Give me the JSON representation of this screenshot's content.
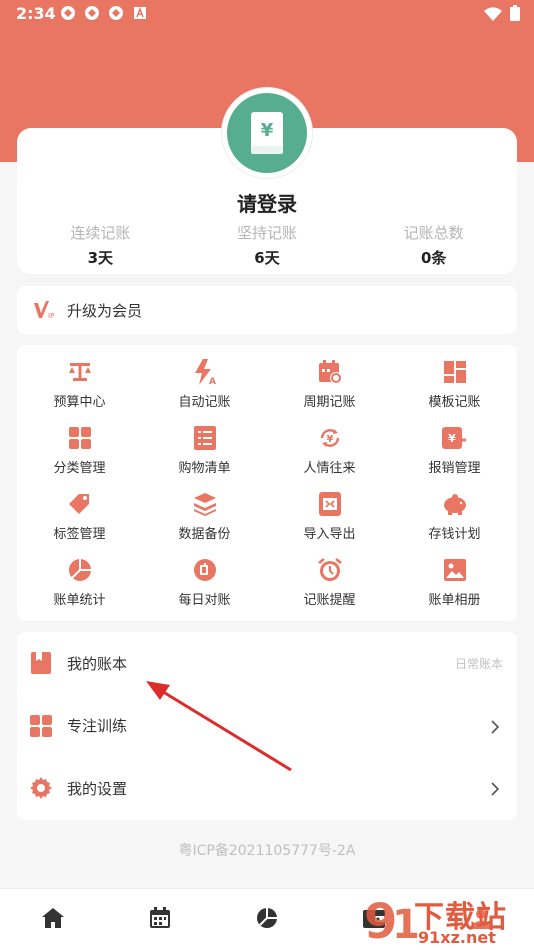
{
  "status_bar": {
    "time": "2:34"
  },
  "profile": {
    "title": "请登录",
    "stats": [
      {
        "label": "连续记账",
        "value": "3天"
      },
      {
        "label": "坚持记账",
        "value": "6天"
      },
      {
        "label": "记账总数",
        "value": "0条"
      }
    ]
  },
  "vip": {
    "label": "升级为会员"
  },
  "grid": {
    "items": [
      {
        "label": "预算中心",
        "icon": "scale-icon"
      },
      {
        "label": "自动记账",
        "icon": "auto-bolt-icon"
      },
      {
        "label": "周期记账",
        "icon": "calendar-cycle-icon"
      },
      {
        "label": "模板记账",
        "icon": "template-icon"
      },
      {
        "label": "分类管理",
        "icon": "category-grid-icon"
      },
      {
        "label": "购物清单",
        "icon": "list-icon"
      },
      {
        "label": "人情往来",
        "icon": "exchange-icon"
      },
      {
        "label": "报销管理",
        "icon": "reimburse-icon"
      },
      {
        "label": "标签管理",
        "icon": "tag-icon"
      },
      {
        "label": "数据备份",
        "icon": "layers-icon"
      },
      {
        "label": "导入导出",
        "icon": "excel-icon"
      },
      {
        "label": "存钱计划",
        "icon": "piggy-bank-icon"
      },
      {
        "label": "账单统计",
        "icon": "pie-chart-icon"
      },
      {
        "label": "每日对账",
        "icon": "daily-check-icon"
      },
      {
        "label": "记账提醒",
        "icon": "alarm-icon"
      },
      {
        "label": "账单相册",
        "icon": "photo-icon"
      }
    ]
  },
  "menu": {
    "books": {
      "label": "我的账本",
      "value": "日常账本"
    },
    "focus": {
      "label": "专注训练"
    },
    "settings": {
      "label": "我的设置"
    }
  },
  "footer": {
    "icp": "粤ICP备2021105777号-2A"
  },
  "watermark": {
    "line1": "下载站",
    "line2": "91xz.net"
  },
  "colors": {
    "accent": "#e97563",
    "avatar": "#56ad8f"
  }
}
